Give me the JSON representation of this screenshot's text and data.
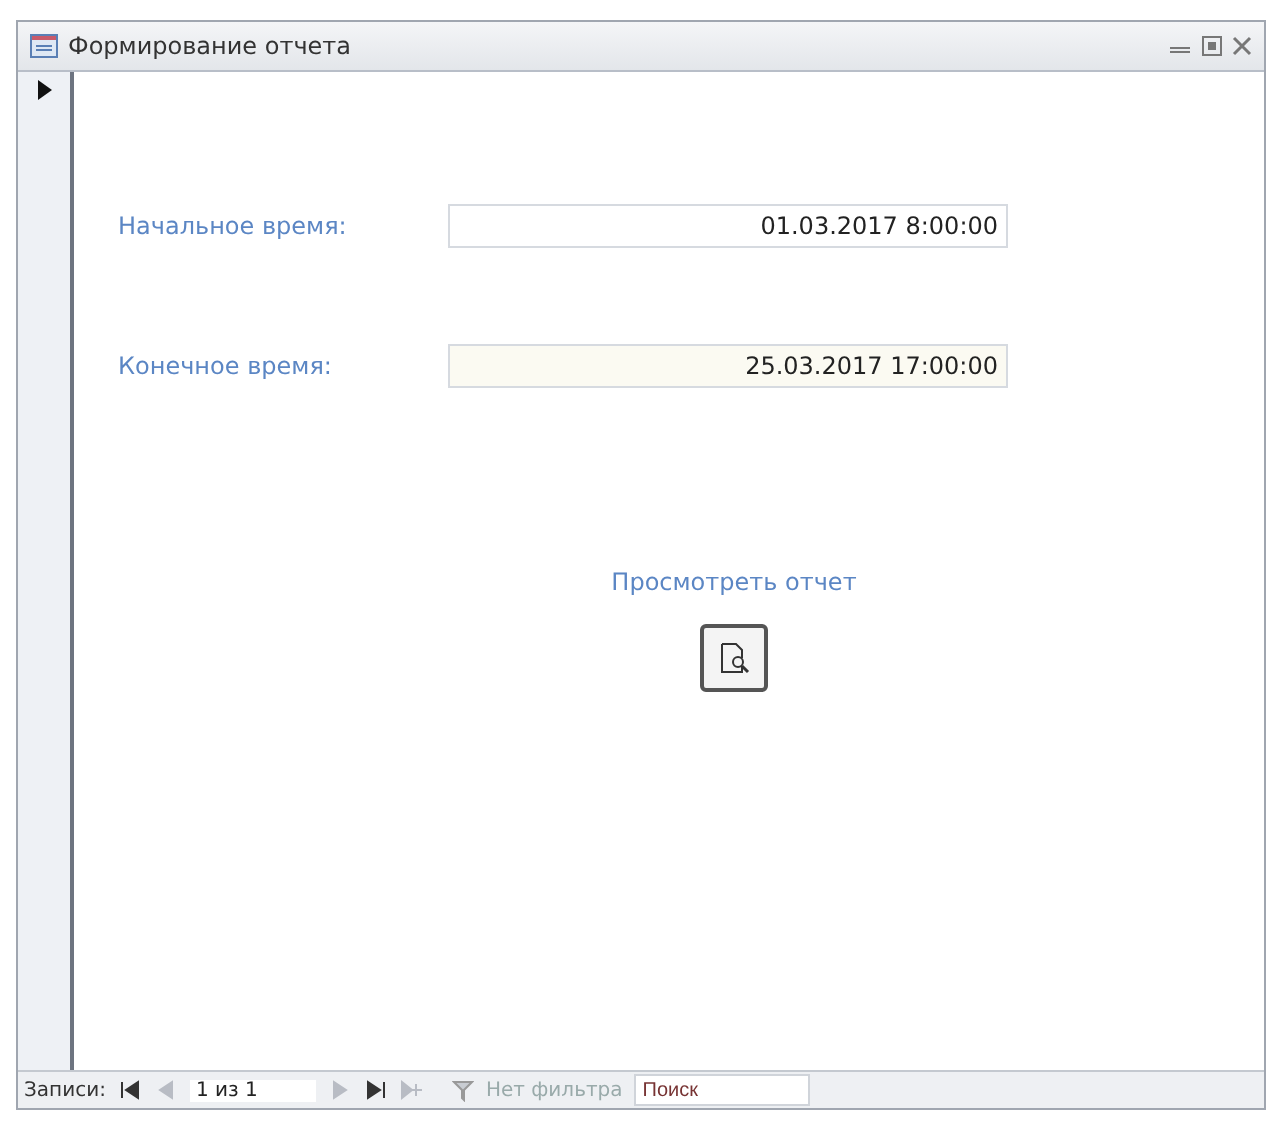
{
  "window": {
    "title": "Формирование отчета"
  },
  "fields": [
    {
      "label": "Начальное время:",
      "value": "01.03.2017 8:00:00"
    },
    {
      "label": "Конечное время:",
      "value": "25.03.2017 17:00:00"
    }
  ],
  "report_button": {
    "label": "Просмотреть отчет"
  },
  "navigation": {
    "label": "Записи:",
    "position": "1 из 1",
    "filter": "Нет фильтра",
    "search": {
      "placeholder": "Поиск"
    },
    "buttons": [
      {
        "kind": "first",
        "disabled": false
      },
      {
        "kind": "prev",
        "disabled": true
      },
      {
        "kind": "next",
        "disabled": true
      },
      {
        "kind": "last",
        "disabled": false
      },
      {
        "kind": "new",
        "disabled": true
      }
    ]
  }
}
